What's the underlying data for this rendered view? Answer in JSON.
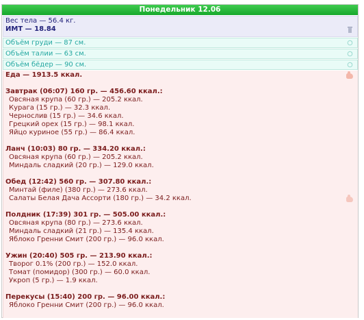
{
  "header": {
    "title": "Понедельник 12.06"
  },
  "weight": {
    "line1": "Вес тела — 56.4 кг.",
    "line2": "ИМТ — 18.84"
  },
  "measures": [
    {
      "text": "Объём груди — 87 см."
    },
    {
      "text": "Объём талии — 63 см."
    },
    {
      "text": "Объём бёдер — 90 см."
    }
  ],
  "food": {
    "total": "Еда — 1913.5 ккал.",
    "meals": [
      {
        "head": "Завтрак (06:07) 160 гр. — 456.60 ккал.:",
        "items": [
          "Овсяная крупа (60 гр.) — 205.2 ккал.",
          "Курага (15 гр.) — 32.3 ккал.",
          "Чернослив (15 гр.) — 34.6 ккал.",
          "Грецкий орех (15 гр.) — 98.1 ккал.",
          "Яйцо куриное (55 гр.) — 86.4 ккал."
        ]
      },
      {
        "head": "Ланч (10:03) 80 гр. — 334.20 ккал.:",
        "items": [
          "Овсяная крупа (60 гр.) — 205.2 ккал.",
          "Миндаль сладкий (20 гр.) — 129.0 ккал."
        ]
      },
      {
        "head": "Обед (12:42) 560 гр. — 307.80 ккал.:",
        "items": [
          "Минтай (филе) (380 гр.) — 273.6 ккал.",
          "Салаты Белая Дача Ассорти (180 гр.) — 34.2 ккал."
        ]
      },
      {
        "head": "Полдник (17:39) 301 гр. — 505.00 ккал.:",
        "items": [
          "Овсяная крупа (80 гр.) — 273.6 ккал.",
          "Миндаль сладкий (21 гр.) — 135.4 ккал.",
          "Яблоко Гренни Смит (200 гр.) — 96.0 ккал."
        ]
      },
      {
        "head": "Ужин (20:40) 505 гр. — 213.90 ккал.:",
        "items": [
          "Творог 0.1% (200 гр.) — 152.0 ккал.",
          "Томат (помидор) (300 гр.) — 60.0 ккал.",
          "Укроп (5 гр.) — 1.9 ккал."
        ]
      },
      {
        "head": "Перекусы (15:40) 200 гр. — 96.00 ккал.:",
        "items": [
          "Яблоко Гренни Смит (200 гр.) — 96.0 ккал."
        ]
      }
    ]
  }
}
